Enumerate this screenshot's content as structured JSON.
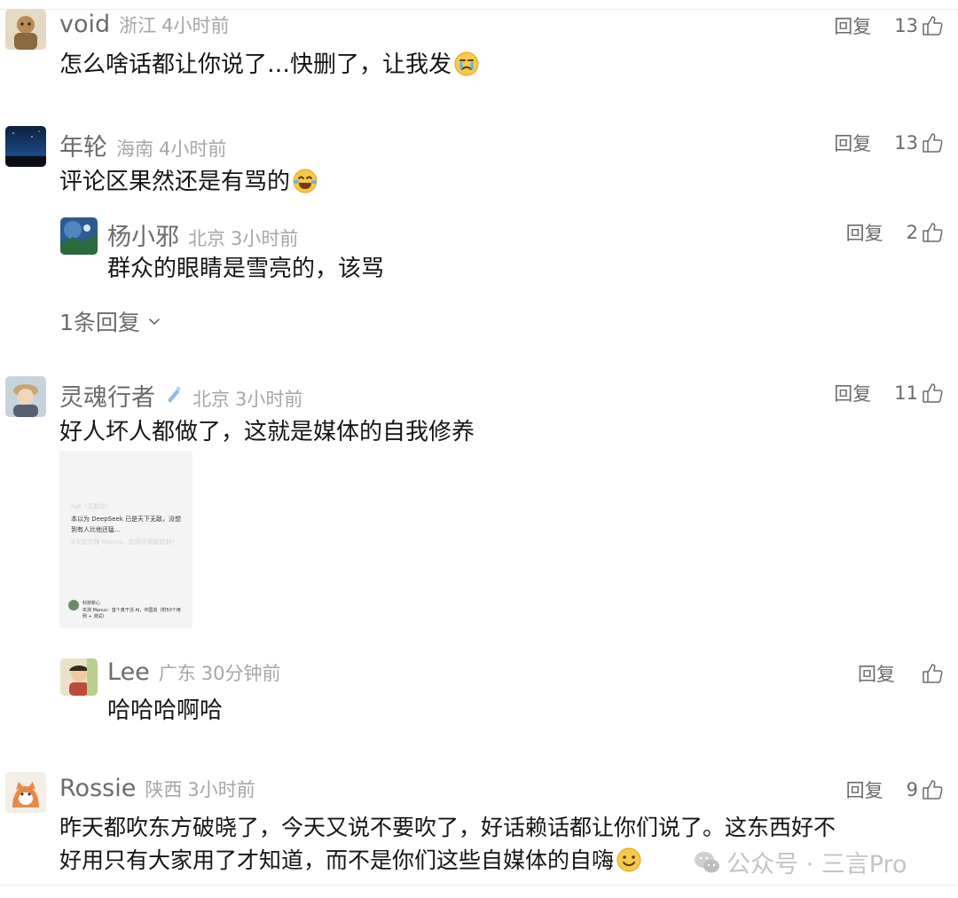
{
  "common": {
    "reply_label": "回复"
  },
  "comments": [
    {
      "user": "void",
      "region": "浙江",
      "time": "4小时前",
      "likes": "13",
      "text": "怎么啥话都让你说了…快删了，让我发",
      "emoji": "crying-face-emoji"
    },
    {
      "user": "年轮",
      "region": "海南",
      "time": "4小时前",
      "likes": "13",
      "text": "评论区果然还是有骂的",
      "emoji": "tears-of-joy-emoji",
      "replies": [
        {
          "user": "杨小邪",
          "region": "北京",
          "time": "3小时前",
          "likes": "2",
          "text": "群众的眼睛是雪亮的，该骂"
        }
      ],
      "more_replies": "1条回复"
    },
    {
      "user": "灵魂行者",
      "badge": "droplet-badge-icon",
      "region": "北京",
      "time": "3小时前",
      "likes": "11",
      "text": "好人坏人都做了，这就是媒体的自我修养",
      "image": {
        "line1": "nut（沉默中）",
        "line2": "本以为 DeepSeek 已是天下无敌，没想",
        "line3": "到有人比他还猛…",
        "line4": "8天前冷静 Manus，这场评测新胜利！",
        "line5": "科技新心",
        "line6": "实测 Manus：首个真干活 AI，中国造（附50个用",
        "line7": "例 + 测试）"
      },
      "replies": [
        {
          "user": "Lee",
          "region": "广东",
          "time": "30分钟前",
          "likes": "",
          "text": "哈哈哈啊哈"
        }
      ]
    },
    {
      "user": "Rossie",
      "region": "陕西",
      "time": "3小时前",
      "likes": "9",
      "text_line1": "昨天都吹东方破晓了，今天又说不要吹了，好话赖话都让你们说了。这东西好不",
      "text_line2": "好用只有大家用了才知道，而不是你们这些自媒体的自嗨",
      "emoji": "smiling-face-emoji"
    }
  ],
  "watermark": {
    "text": "公众号 · 三言Pro"
  }
}
